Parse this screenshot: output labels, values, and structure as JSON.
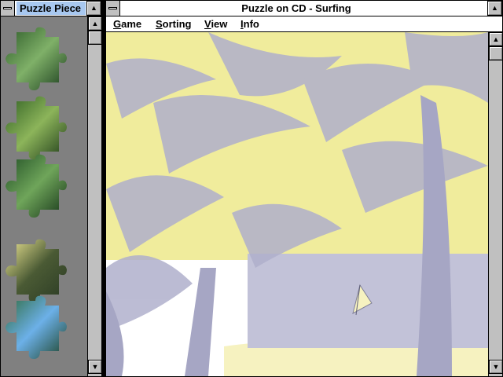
{
  "pieces_window": {
    "title": "Puzzle Piece",
    "scroll_up_icon": "arrow-up",
    "scroll_down_icon": "arrow-down",
    "pieces": [
      {
        "colors": [
          "#2c5a28",
          "#7fb068",
          "#183a1c"
        ]
      },
      {
        "colors": [
          "#2e5e22",
          "#8cb45a",
          "#1c3818"
        ]
      },
      {
        "colors": [
          "#1f4d24",
          "#6fa55a",
          "#123016"
        ]
      },
      {
        "colors": [
          "#f2ea96",
          "#4a5a34",
          "#2a3a24"
        ]
      },
      {
        "colors": [
          "#2e6a3c",
          "#6cb0e8",
          "#1a3e20"
        ]
      }
    ]
  },
  "main_window": {
    "title": "Puzzle on CD - Surfing",
    "menu": [
      {
        "accel": "G",
        "rest": "ame"
      },
      {
        "accel": "S",
        "rest": "orting"
      },
      {
        "accel": "V",
        "rest": "iew"
      },
      {
        "accel": "I",
        "rest": "nfo"
      }
    ],
    "colors": {
      "sky": "#f0ec9c",
      "palm_shadow": "#b0b0cc",
      "sea": "#c2c2d8",
      "sand": "#f6f2c0"
    }
  }
}
